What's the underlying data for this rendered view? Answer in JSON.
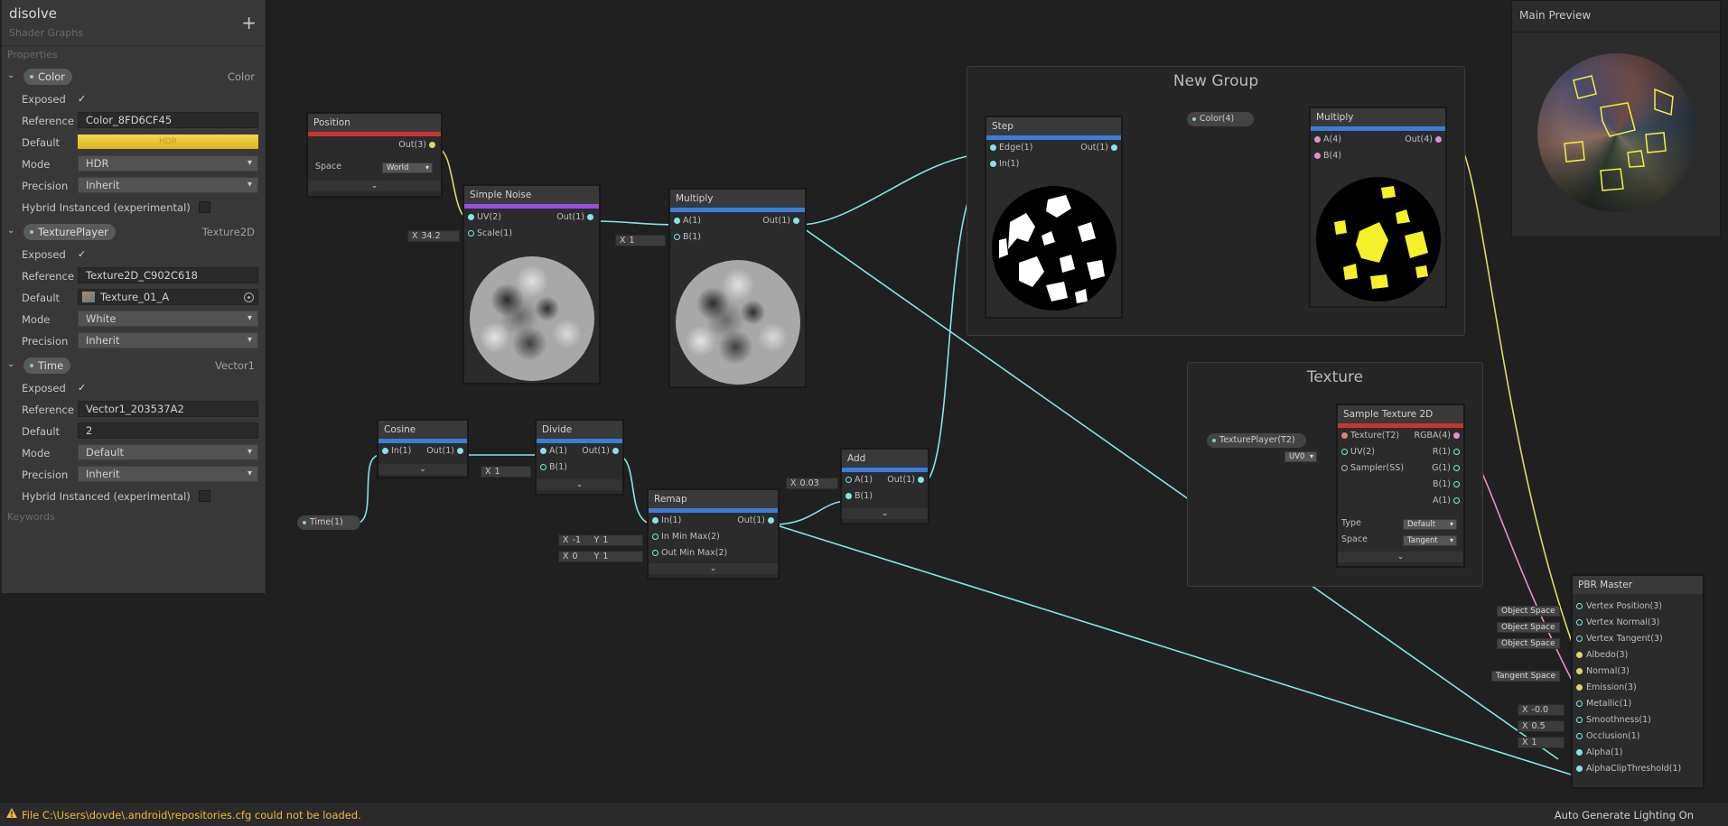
{
  "blackboard": {
    "title": "disolve",
    "subtitle": "Shader Graphs",
    "add_label": "+",
    "properties_label": "Properties",
    "keywords_label": "Keywords",
    "props": [
      {
        "name": "Color",
        "type": "Color",
        "exposed_label": "Exposed",
        "reference_label": "Reference",
        "reference": "Color_8FD6CF45",
        "default_label": "Default",
        "default_text": "HDR",
        "mode_label": "Mode",
        "mode": "HDR",
        "precision_label": "Precision",
        "precision": "Inherit",
        "hybrid_label": "Hybrid Instanced (experimental)"
      },
      {
        "name": "TexturePlayer",
        "type": "Texture2D",
        "exposed_label": "Exposed",
        "reference_label": "Reference",
        "reference": "Texture2D_C902C618",
        "default_label": "Default",
        "default_text": "Texture_01_A",
        "mode_label": "Mode",
        "mode": "White",
        "precision_label": "Precision",
        "precision": "Inherit"
      },
      {
        "name": "Time",
        "type": "Vector1",
        "exposed_label": "Exposed",
        "reference_label": "Reference",
        "reference": "Vector1_203537A2",
        "default_label": "Default",
        "default_text": "2",
        "mode_label": "Mode",
        "mode": "Default",
        "precision_label": "Precision",
        "precision": "Inherit",
        "hybrid_label": "Hybrid Instanced (experimental)"
      }
    ]
  },
  "nodes": {
    "position": {
      "title": "Position",
      "out": "Out(3)",
      "space_label": "Space",
      "space": "World"
    },
    "simple_noise": {
      "title": "Simple Noise",
      "in1": "UV(2)",
      "in2": "Scale(1)",
      "out": "Out(1)",
      "scale_x": "X",
      "scale_val": "34.2"
    },
    "multiply1": {
      "title": "Multiply",
      "in1": "A(1)",
      "in2": "B(1)",
      "out": "Out(1)",
      "b_x": "X",
      "b_val": "1"
    },
    "cosine": {
      "title": "Cosine",
      "in1": "In(1)",
      "out": "Out(1)"
    },
    "divide": {
      "title": "Divide",
      "in1": "A(1)",
      "in2": "B(1)",
      "out": "Out(1)",
      "b_x": "X",
      "b_val": "1"
    },
    "remap": {
      "title": "Remap",
      "in1": "In(1)",
      "in2": "In Min Max(2)",
      "in3": "Out Min Max(2)",
      "out": "Out(1)",
      "x_label": "X",
      "y_label": "Y",
      "in_min": "-1",
      "in_max": "1",
      "out_min": "0",
      "out_max": "1"
    },
    "add": {
      "title": "Add",
      "in1": "A(1)",
      "in2": "B(1)",
      "out": "Out(1)",
      "a_x": "X",
      "a_val": "0.03"
    },
    "step": {
      "title": "Step",
      "in1": "Edge(1)",
      "in2": "In(1)",
      "out": "Out(1)"
    },
    "multiply2": {
      "title": "Multiply",
      "in1": "A(4)",
      "in2": "B(4)",
      "out": "Out(4)"
    },
    "sample_tex": {
      "title": "Sample Texture 2D",
      "in1": "Texture(T2)",
      "in2": "UV(2)",
      "in3": "Sampler(SS)",
      "out1": "RGBA(4)",
      "out2": "R(1)",
      "out3": "G(1)",
      "out4": "B(1)",
      "out5": "A(1)",
      "uv_sel": "UV0",
      "type_label": "Type",
      "type": "Default",
      "space_label": "Space",
      "space": "Tangent"
    },
    "pbr": {
      "title": "PBR Master",
      "inputs": [
        "Vertex Position(3)",
        "Vertex Normal(3)",
        "Vertex Tangent(3)",
        "Albedo(3)",
        "Normal(3)",
        "Emission(3)",
        "Metallic(1)",
        "Smoothness(1)",
        "Occlusion(1)",
        "Alpha(1)",
        "AlphaClipThreshold(1)"
      ],
      "space_tags": [
        "Object Space",
        "Object Space",
        "Object Space",
        "Tangent Space"
      ],
      "x_label": "X",
      "metallic": "-0.0",
      "smoothness": "0.5",
      "occlusion": "1"
    },
    "color_prop": "Color(4)",
    "texture_prop": "TexturePlayer(T2)",
    "time_prop": "Time(1)"
  },
  "groups": {
    "new_group": "New Group",
    "texture": "Texture"
  },
  "preview": {
    "title": "Main Preview"
  },
  "status": {
    "message": "File C:\\Users\\dovde\\.android\\repositories.cfg could not be loaded.",
    "right": "Auto Generate Lighting On",
    "warn_color": "#f0b83c"
  },
  "colors": {
    "wire": "#84e4e7",
    "wire_yellow": "#dcd86a",
    "wire_pink": "#e48fcd",
    "accent_blue": "#3b7ddb",
    "accent_red": "#c93434",
    "accent_purple": "#9b4de0"
  }
}
